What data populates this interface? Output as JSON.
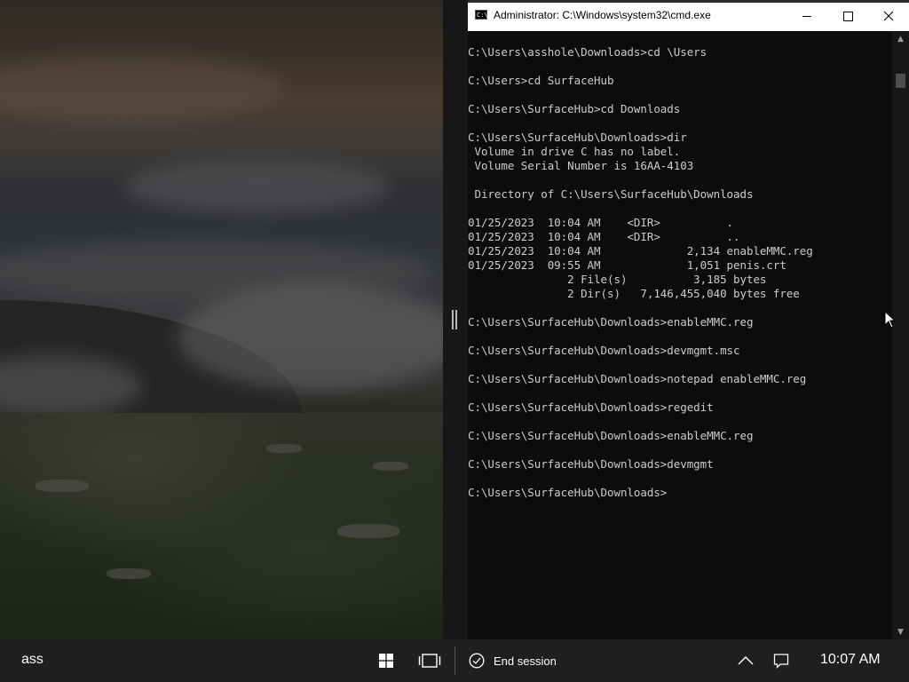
{
  "taskbar": {
    "label": "ass",
    "end_session_label": "End session",
    "clock": "10:07 AM",
    "icons": [
      "windows-start-icon",
      "task-view-icon",
      "end-session-icon",
      "show-hidden-icons-chevron",
      "action-center-icon"
    ]
  },
  "cmd": {
    "title": "Administrator: C:\\Windows\\system32\\cmd.exe",
    "title_icon": "C:\\",
    "lines": [
      "",
      "C:\\Users\\asshole\\Downloads>cd \\Users",
      "",
      "C:\\Users>cd SurfaceHub",
      "",
      "C:\\Users\\SurfaceHub>cd Downloads",
      "",
      "C:\\Users\\SurfaceHub\\Downloads>dir",
      " Volume in drive C has no label.",
      " Volume Serial Number is 16AA-4103",
      "",
      " Directory of C:\\Users\\SurfaceHub\\Downloads",
      "",
      "01/25/2023  10:04 AM    <DIR>          .",
      "01/25/2023  10:04 AM    <DIR>          ..",
      "01/25/2023  10:04 AM             2,134 enableMMC.reg",
      "01/25/2023  09:55 AM             1,051 penis.crt",
      "               2 File(s)          3,185 bytes",
      "               2 Dir(s)   7,146,455,040 bytes free",
      "",
      "C:\\Users\\SurfaceHub\\Downloads>enableMMC.reg",
      "",
      "C:\\Users\\SurfaceHub\\Downloads>devmgmt.msc",
      "",
      "C:\\Users\\SurfaceHub\\Downloads>notepad enableMMC.reg",
      "",
      "C:\\Users\\SurfaceHub\\Downloads>regedit",
      "",
      "C:\\Users\\SurfaceHub\\Downloads>enableMMC.reg",
      "",
      "C:\\Users\\SurfaceHub\\Downloads>devmgmt",
      "",
      "C:\\Users\\SurfaceHub\\Downloads>"
    ]
  },
  "colors": {
    "console_bg": "#0c0c0c",
    "console_text": "#cccccc",
    "taskbar_bg": "#1f1f1f",
    "titlebar_bg": "#ffffff"
  }
}
